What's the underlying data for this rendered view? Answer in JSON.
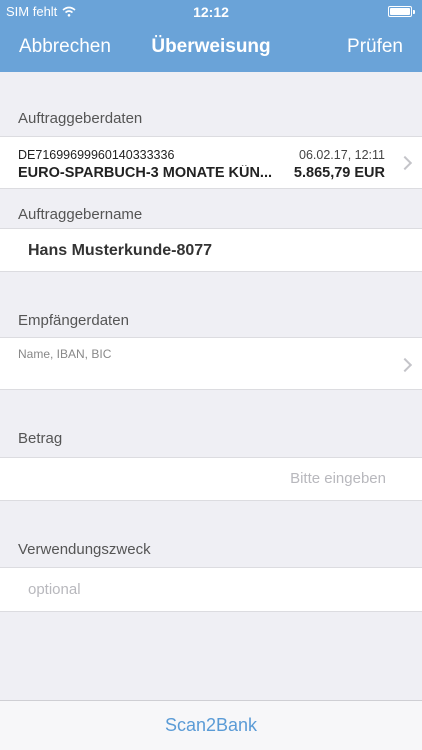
{
  "status": {
    "carrier": "SIM fehlt",
    "time": "12:12",
    "icons": [
      "wifi-icon",
      "battery-icon"
    ]
  },
  "nav": {
    "cancel_label": "Abbrechen",
    "title": "Überweisung",
    "check_label": "Prüfen"
  },
  "sender": {
    "section_label": "Auftraggeberdaten",
    "iban": "DE71699699960140333336",
    "date": "06.02.17, 12:11",
    "account_name": "EURO-SPARBUCH-3 MONATE KÜN...",
    "balance": "5.865,79 EUR",
    "name_label": "Auftraggebername",
    "name_value": "Hans Musterkunde-8077"
  },
  "recipient": {
    "section_label": "Empfängerdaten",
    "placeholder": "Name, IBAN, BIC"
  },
  "amount": {
    "section_label": "Betrag",
    "placeholder": "Bitte eingeben"
  },
  "purpose": {
    "section_label": "Verwendungszweck",
    "placeholder": "optional"
  },
  "bottom": {
    "button_label": "Scan2Bank"
  },
  "colors": {
    "accent": "#6aa3d8",
    "background": "#efeff4",
    "link": "#5a9bd6"
  }
}
